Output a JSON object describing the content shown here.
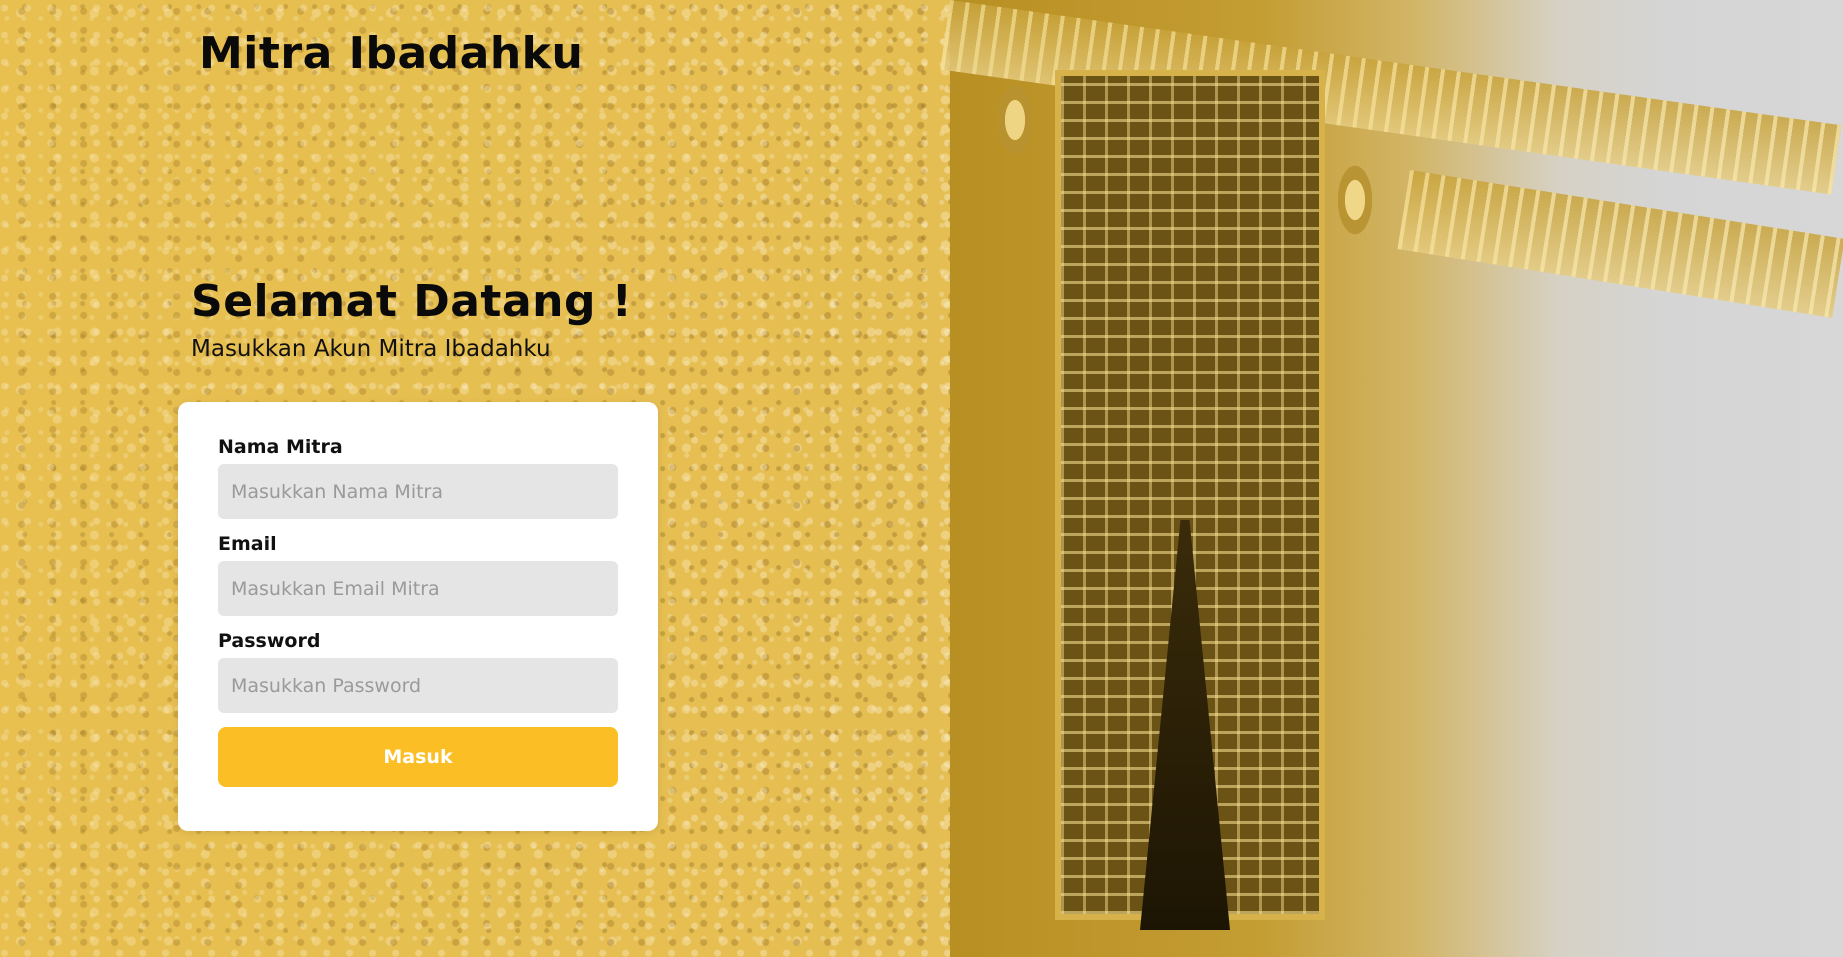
{
  "brand": {
    "name": "Mitra Ibadahku"
  },
  "hero": {
    "title": "Selamat Datang !",
    "subtitle": "Masukkan Akun Mitra Ibadahku"
  },
  "form": {
    "fields": [
      {
        "label": "Nama Mitra",
        "value": "",
        "placeholder": "Masukkan Nama Mitra"
      },
      {
        "label": "Email",
        "value": "",
        "placeholder": "Masukkan Email Mitra"
      },
      {
        "label": "Password",
        "value": "",
        "placeholder": "Masukkan Password"
      }
    ],
    "submit_label": "Masuk"
  },
  "colors": {
    "accent": "#fbbe24",
    "input_bg": "#e5e5e5",
    "card_bg": "#ffffff",
    "overlay_gold": "#e3bd55"
  }
}
